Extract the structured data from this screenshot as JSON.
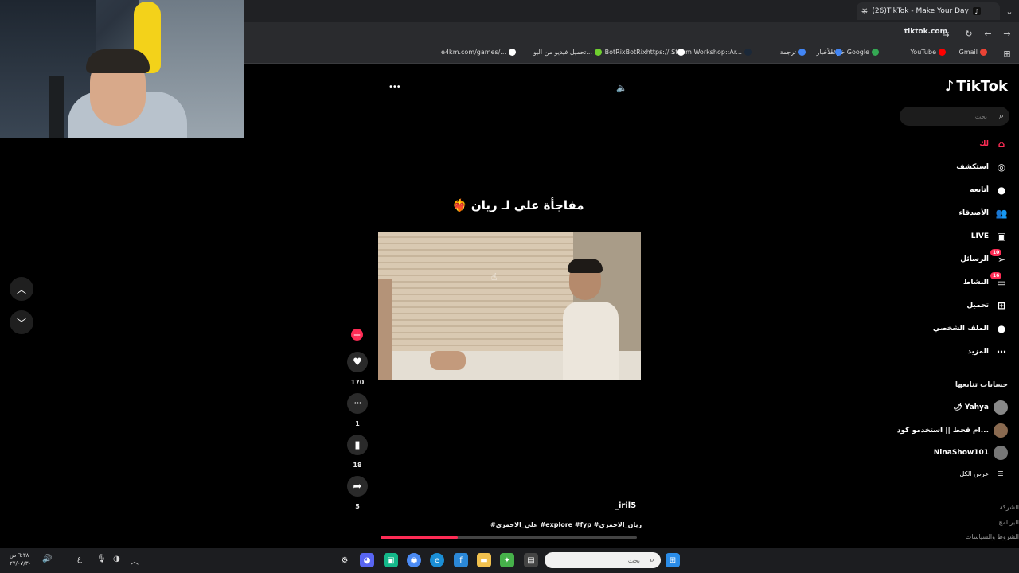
{
  "browser": {
    "tab_title": "(26)TikTok - Make Your Day",
    "url": "tiktok.com",
    "bookmarks": [
      {
        "label": "Gmail",
        "color": "#ea4335"
      },
      {
        "label": "YouTube",
        "color": "#ff0000"
      },
      {
        "label": "خرائط Google",
        "color": "#34a853"
      },
      {
        "label": "الأخبار",
        "color": "#4285f4"
      },
      {
        "label": "ترجمة",
        "color": "#4285f4"
      },
      {
        "label": "Steam Workshop::Ar...",
        "color": "#1b2838"
      },
      {
        "label": "BotRixBotRixhttps://...",
        "color": "#ffffff"
      },
      {
        "label": "تحميل فيديو من اليو...",
        "color": "#6fcf2f"
      },
      {
        "label": "e4km.com/games/...",
        "color": "#ffffff"
      }
    ]
  },
  "sidebar": {
    "logo": "TikTok",
    "search_placeholder": "بحث",
    "nav": [
      {
        "label": "لك",
        "icon": "home-icon",
        "glyph": "⌂",
        "active": true
      },
      {
        "label": "استكشف",
        "icon": "compass-icon",
        "glyph": "◎"
      },
      {
        "label": "أتابعه",
        "icon": "following-avatar-icon",
        "glyph": "●"
      },
      {
        "label": "الأصدقاء",
        "icon": "friends-icon",
        "glyph": "👥"
      },
      {
        "label": "LIVE",
        "icon": "live-icon",
        "glyph": "▣"
      },
      {
        "label": "الرسائل",
        "icon": "messages-icon",
        "glyph": "➢",
        "badge": "10"
      },
      {
        "label": "النشاط",
        "icon": "activity-icon",
        "glyph": "▭",
        "badge": "16"
      },
      {
        "label": "تحميل",
        "icon": "upload-icon",
        "glyph": "⊞"
      },
      {
        "label": "الملف الشخصي",
        "icon": "profile-icon",
        "glyph": "●"
      },
      {
        "label": "المزيد",
        "icon": "more-icon",
        "glyph": "⋯"
      }
    ],
    "following_title": "حسابات تتابعها",
    "following": [
      {
        "name": "🌶 Yahya",
        "color": "#888"
      },
      {
        "name": "ام قحط || استخدمو كود...",
        "color": "#8a6a50"
      },
      {
        "name": "NinaShow101",
        "color": "#777"
      }
    ],
    "show_all": "عرض الكل",
    "footer": [
      "الشركة",
      "البرنامج",
      "الشروط والسياسات"
    ]
  },
  "video": {
    "caption": "مفاجأة علي لـ ريان ❤️‍🔥",
    "author": "_iril5",
    "hashtags": "#علي_الاحمري #explore #fyp #ريان_الاحمري",
    "progress": 0.3,
    "actions": [
      {
        "name": "like",
        "glyph": "♥",
        "count": "170"
      },
      {
        "name": "comment",
        "glyph": "•••",
        "count": "1"
      },
      {
        "name": "bookmark",
        "glyph": "▮",
        "count": "18"
      },
      {
        "name": "share",
        "glyph": "➦",
        "count": "5"
      }
    ],
    "more_glyph": "•••",
    "sound_glyph": "🔈"
  },
  "taskbar": {
    "search_placeholder": "بحث",
    "clock_time": "٦:٣٨ ص",
    "clock_date": "٢٧/٠٧/٣٠",
    "lang": "ع"
  }
}
